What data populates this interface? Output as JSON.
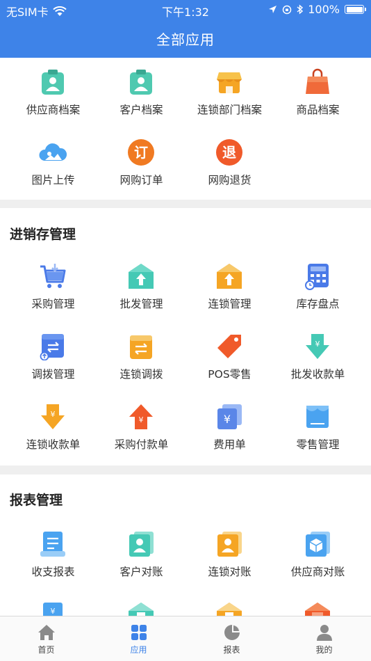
{
  "status_bar": {
    "carrier": "无SIM卡",
    "time": "下午1:32",
    "battery": "100%"
  },
  "header": {
    "title": "全部应用"
  },
  "top_section": {
    "items": [
      {
        "label": "供应商档案",
        "icon": "supplier-file-icon",
        "color": "#4fc9b0"
      },
      {
        "label": "客户档案",
        "icon": "customer-file-icon",
        "color": "#4fc9b0"
      },
      {
        "label": "连锁部门档案",
        "icon": "store-icon",
        "color": "#f5a524"
      },
      {
        "label": "商品档案",
        "icon": "shopping-bag-icon",
        "color": "#f06a3a"
      },
      {
        "label": "图片上传",
        "icon": "cloud-upload-icon",
        "color": "#4aa3f0"
      },
      {
        "label": "网购订单",
        "icon": "order-icon",
        "glyph": "订",
        "color": "#f07a22"
      },
      {
        "label": "网购退货",
        "icon": "return-icon",
        "glyph": "退",
        "color": "#f05a2a"
      }
    ]
  },
  "inventory_section": {
    "title": "进销存管理",
    "items": [
      {
        "label": "采购管理",
        "icon": "cart-icon",
        "color": "#4a7ae8"
      },
      {
        "label": "批发管理",
        "icon": "warehouse-teal-icon",
        "color": "#45c9b5"
      },
      {
        "label": "连锁管理",
        "icon": "warehouse-orange-icon",
        "color": "#f5a524"
      },
      {
        "label": "库存盘点",
        "icon": "calculator-icon",
        "color": "#4a7ae8"
      },
      {
        "label": "调拨管理",
        "icon": "transfer-window-icon",
        "color": "#4a7ae8"
      },
      {
        "label": "连锁调拨",
        "icon": "chain-transfer-icon",
        "color": "#f5a524"
      },
      {
        "label": "POS零售",
        "icon": "price-tag-icon",
        "color": "#f05a2a"
      },
      {
        "label": "批发收款单",
        "icon": "arrow-down-teal-icon",
        "color": "#45c9b5"
      },
      {
        "label": "连锁收款单",
        "icon": "arrow-down-orange-icon",
        "color": "#f5a524"
      },
      {
        "label": "采购付款单",
        "icon": "arrow-up-red-icon",
        "color": "#f05a2a"
      },
      {
        "label": "费用单",
        "icon": "expense-cards-icon",
        "color": "#5a86e8"
      },
      {
        "label": "零售管理",
        "icon": "retail-icon",
        "color": "#4aa3f0"
      }
    ]
  },
  "report_section": {
    "title": "报表管理",
    "items": [
      {
        "label": "收支报表",
        "icon": "income-report-icon",
        "color": "#4aa3f0"
      },
      {
        "label": "客户对账",
        "icon": "customer-reconcile-icon",
        "color": "#45c9b5"
      },
      {
        "label": "连锁对账",
        "icon": "chain-reconcile-icon",
        "color": "#f5a524"
      },
      {
        "label": "供应商对账",
        "icon": "supplier-reconcile-icon",
        "color": "#4aa3f0"
      }
    ]
  },
  "tab_bar": {
    "tabs": [
      {
        "label": "首页",
        "icon": "home-icon"
      },
      {
        "label": "应用",
        "icon": "apps-icon",
        "active": true
      },
      {
        "label": "报表",
        "icon": "pie-chart-icon"
      },
      {
        "label": "我的",
        "icon": "profile-icon"
      }
    ]
  }
}
